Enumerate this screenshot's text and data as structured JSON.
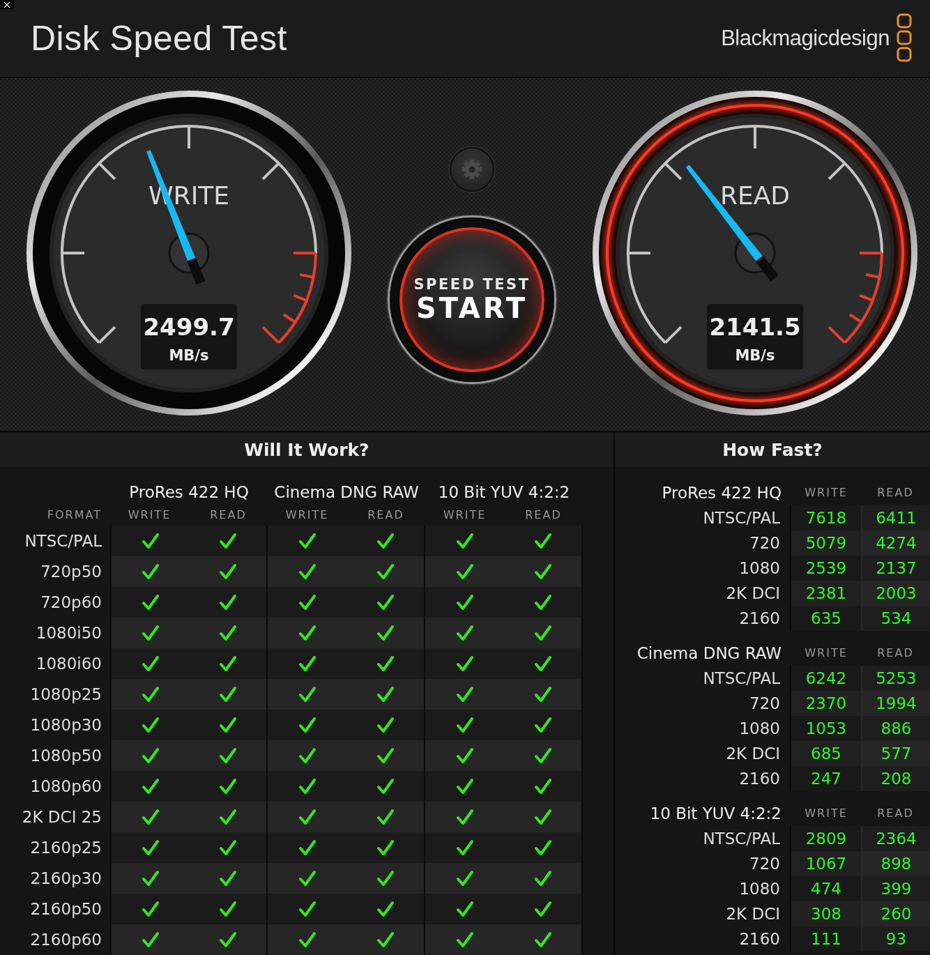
{
  "window": {
    "title": "Disk Speed Test",
    "close": "×"
  },
  "brand": {
    "name": "Blackmagicdesign"
  },
  "gauges": [
    {
      "label": "WRITE",
      "value": "2499.7",
      "unit": "MB/s",
      "level": 0.42,
      "glow": false
    },
    {
      "label": "READ",
      "value": "2141.5",
      "unit": "MB/s",
      "level": 0.36,
      "glow": true
    }
  ],
  "start_button": {
    "caption": "SPEED TEST",
    "label": "START"
  },
  "will_it_work": {
    "title": "Will It Work?",
    "format_header": "FORMAT",
    "codecs": [
      {
        "name": "ProRes 422 HQ",
        "columns": [
          "WRITE",
          "READ"
        ]
      },
      {
        "name": "Cinema DNG RAW",
        "columns": [
          "WRITE",
          "READ"
        ]
      },
      {
        "name": "10 Bit YUV 4:2:2",
        "columns": [
          "WRITE",
          "READ"
        ]
      }
    ],
    "rows": [
      {
        "format": "NTSC/PAL",
        "checks": [
          true,
          true,
          true,
          true,
          true,
          true
        ]
      },
      {
        "format": "720p50",
        "checks": [
          true,
          true,
          true,
          true,
          true,
          true
        ]
      },
      {
        "format": "720p60",
        "checks": [
          true,
          true,
          true,
          true,
          true,
          true
        ]
      },
      {
        "format": "1080i50",
        "checks": [
          true,
          true,
          true,
          true,
          true,
          true
        ]
      },
      {
        "format": "1080i60",
        "checks": [
          true,
          true,
          true,
          true,
          true,
          true
        ]
      },
      {
        "format": "1080p25",
        "checks": [
          true,
          true,
          true,
          true,
          true,
          true
        ]
      },
      {
        "format": "1080p30",
        "checks": [
          true,
          true,
          true,
          true,
          true,
          true
        ]
      },
      {
        "format": "1080p50",
        "checks": [
          true,
          true,
          true,
          true,
          true,
          true
        ]
      },
      {
        "format": "1080p60",
        "checks": [
          true,
          true,
          true,
          true,
          true,
          true
        ]
      },
      {
        "format": "2K DCI 25",
        "checks": [
          true,
          true,
          true,
          true,
          true,
          true
        ]
      },
      {
        "format": "2160p25",
        "checks": [
          true,
          true,
          true,
          true,
          true,
          true
        ]
      },
      {
        "format": "2160p30",
        "checks": [
          true,
          true,
          true,
          true,
          true,
          true
        ]
      },
      {
        "format": "2160p50",
        "checks": [
          true,
          true,
          true,
          true,
          true,
          true
        ]
      },
      {
        "format": "2160p60",
        "checks": [
          true,
          true,
          true,
          true,
          true,
          true
        ]
      }
    ]
  },
  "how_fast": {
    "title": "How Fast?",
    "groups": [
      {
        "codec": "ProRes 422 HQ",
        "write_header": "WRITE",
        "read_header": "READ",
        "rows": [
          {
            "resolution": "NTSC/PAL",
            "write": "7618",
            "read": "6411"
          },
          {
            "resolution": "720",
            "write": "5079",
            "read": "4274"
          },
          {
            "resolution": "1080",
            "write": "2539",
            "read": "2137"
          },
          {
            "resolution": "2K DCI",
            "write": "2381",
            "read": "2003"
          },
          {
            "resolution": "2160",
            "write": "635",
            "read": "534"
          }
        ]
      },
      {
        "codec": "Cinema DNG RAW",
        "write_header": "WRITE",
        "read_header": "READ",
        "rows": [
          {
            "resolution": "NTSC/PAL",
            "write": "6242",
            "read": "5253"
          },
          {
            "resolution": "720",
            "write": "2370",
            "read": "1994"
          },
          {
            "resolution": "1080",
            "write": "1053",
            "read": "886"
          },
          {
            "resolution": "2K DCI",
            "write": "685",
            "read": "577"
          },
          {
            "resolution": "2160",
            "write": "247",
            "read": "208"
          }
        ]
      },
      {
        "codec": "10 Bit YUV 4:2:2",
        "write_header": "WRITE",
        "read_header": "READ",
        "rows": [
          {
            "resolution": "NTSC/PAL",
            "write": "2809",
            "read": "2364"
          },
          {
            "resolution": "720",
            "write": "1067",
            "read": "898"
          },
          {
            "resolution": "1080",
            "write": "474",
            "read": "399"
          },
          {
            "resolution": "2K DCI",
            "write": "308",
            "read": "260"
          },
          {
            "resolution": "2160",
            "write": "111",
            "read": "93"
          }
        ]
      }
    ]
  }
}
